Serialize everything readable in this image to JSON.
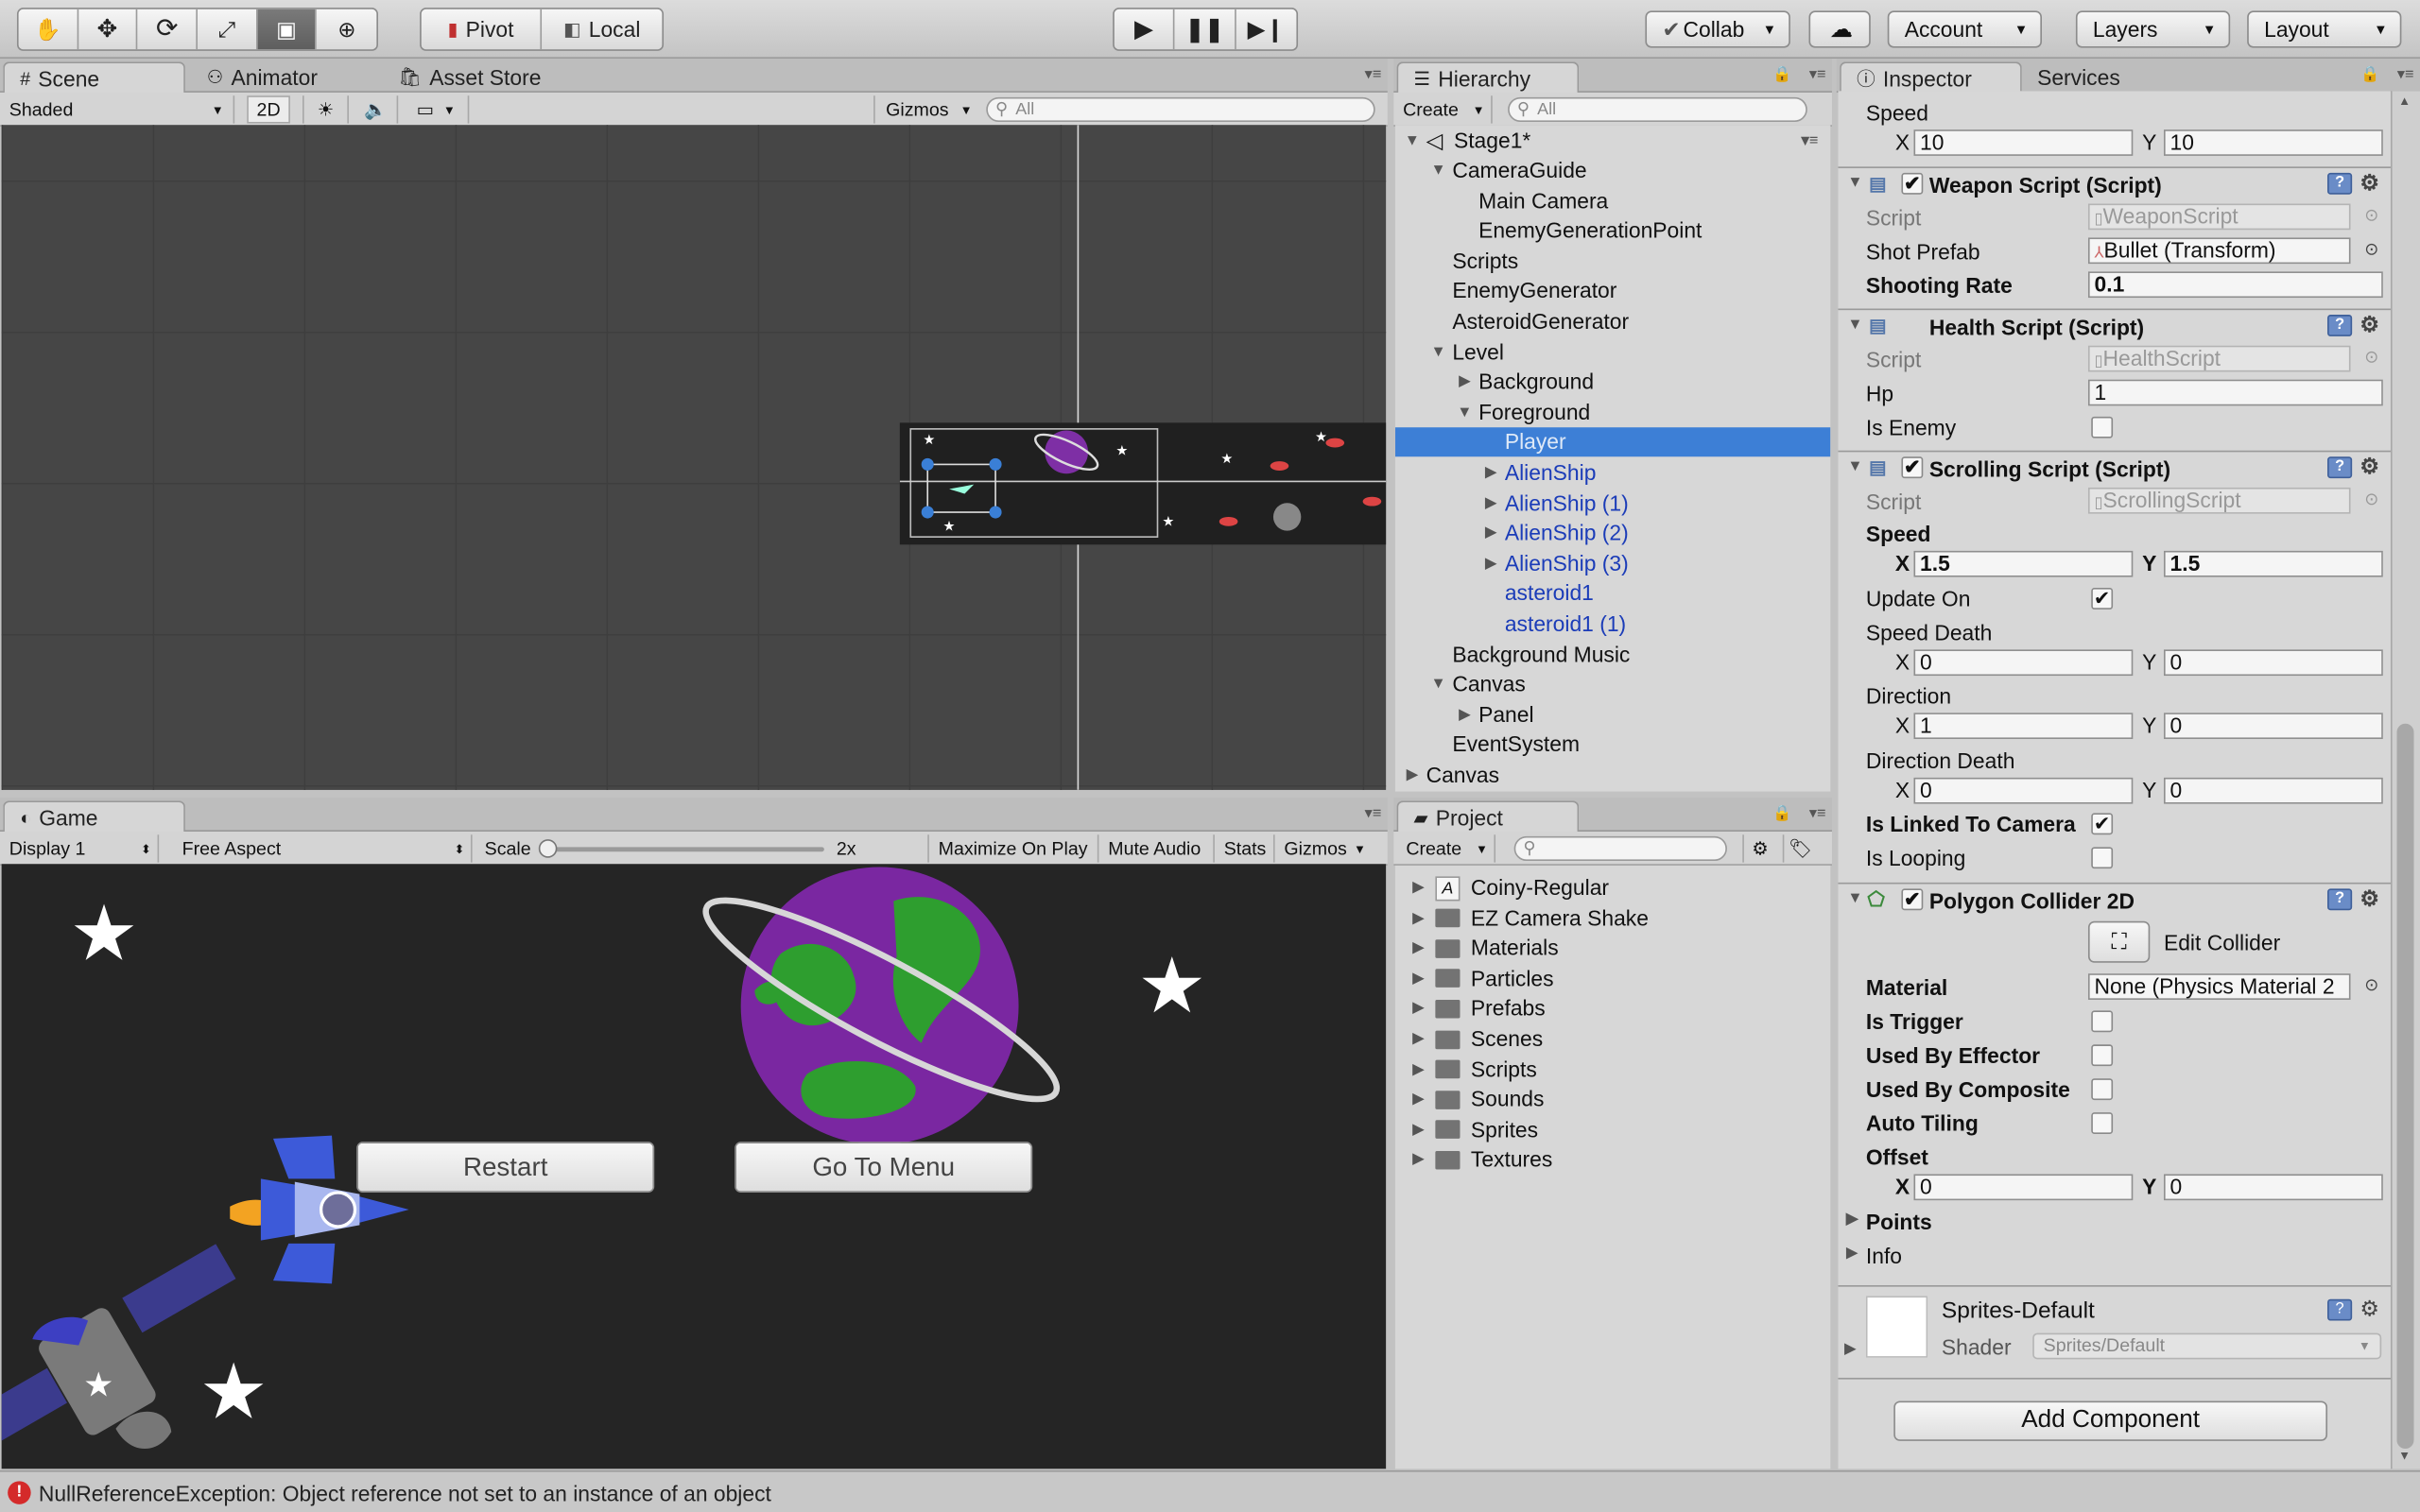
{
  "toolbar": {
    "pivot": "Pivot",
    "local": "Local",
    "collab": "Collab",
    "account": "Account",
    "layers": "Layers",
    "layout": "Layout"
  },
  "scene": {
    "tab_scene": "Scene",
    "tab_animator": "Animator",
    "tab_asset_store": "Asset Store",
    "shading_mode": "Shaded",
    "mode_2d": "2D",
    "gizmos": "Gizmos",
    "search_placeholder": "All"
  },
  "game": {
    "tab": "Game",
    "display": "Display 1",
    "aspect": "Free Aspect",
    "scale_label": "Scale",
    "scale_value": "2x",
    "maximize_on_play": "Maximize On Play",
    "mute_audio": "Mute Audio",
    "stats": "Stats",
    "gizmos": "Gizmos",
    "restart_button": "Restart",
    "go_to_menu_button": "Go To Menu"
  },
  "hierarchy": {
    "tab": "Hierarchy",
    "create": "Create",
    "search_placeholder": "All",
    "scene_name": "Stage1*",
    "rows": [
      {
        "label": "CameraGuide",
        "indent": 1,
        "arrow": "down",
        "style": ""
      },
      {
        "label": "Main Camera",
        "indent": 2,
        "arrow": "",
        "style": ""
      },
      {
        "label": "EnemyGenerationPoint",
        "indent": 2,
        "arrow": "",
        "style": ""
      },
      {
        "label": "Scripts",
        "indent": 1,
        "arrow": "",
        "style": ""
      },
      {
        "label": "EnemyGenerator",
        "indent": 1,
        "arrow": "",
        "style": ""
      },
      {
        "label": "AsteroidGenerator",
        "indent": 1,
        "arrow": "",
        "style": ""
      },
      {
        "label": "Level",
        "indent": 1,
        "arrow": "down",
        "style": ""
      },
      {
        "label": "Background",
        "indent": 2,
        "arrow": "right",
        "style": ""
      },
      {
        "label": "Foreground",
        "indent": 2,
        "arrow": "down",
        "style": ""
      },
      {
        "label": "Player",
        "indent": 3,
        "arrow": "",
        "style": "sel"
      },
      {
        "label": "AlienShip",
        "indent": 3,
        "arrow": "right",
        "style": "blue"
      },
      {
        "label": "AlienShip (1)",
        "indent": 3,
        "arrow": "right",
        "style": "blue"
      },
      {
        "label": "AlienShip (2)",
        "indent": 3,
        "arrow": "right",
        "style": "blue"
      },
      {
        "label": "AlienShip (3)",
        "indent": 3,
        "arrow": "right",
        "style": "blue"
      },
      {
        "label": "asteroid1",
        "indent": 3,
        "arrow": "",
        "style": "blue"
      },
      {
        "label": "asteroid1 (1)",
        "indent": 3,
        "arrow": "",
        "style": "blue"
      },
      {
        "label": "Background Music",
        "indent": 1,
        "arrow": "",
        "style": ""
      },
      {
        "label": "Canvas",
        "indent": 1,
        "arrow": "down",
        "style": ""
      },
      {
        "label": "Panel",
        "indent": 2,
        "arrow": "right",
        "style": ""
      },
      {
        "label": "EventSystem",
        "indent": 1,
        "arrow": "",
        "style": ""
      },
      {
        "label": "Canvas",
        "indent": 0,
        "arrow": "right",
        "style": ""
      }
    ]
  },
  "project": {
    "tab": "Project",
    "create": "Create",
    "items": [
      {
        "label": "Coiny-Regular",
        "kind": "font"
      },
      {
        "label": "EZ Camera Shake",
        "kind": "folder"
      },
      {
        "label": "Materials",
        "kind": "folder"
      },
      {
        "label": "Particles",
        "kind": "folder"
      },
      {
        "label": "Prefabs",
        "kind": "folder"
      },
      {
        "label": "Scenes",
        "kind": "folder"
      },
      {
        "label": "Scripts",
        "kind": "folder"
      },
      {
        "label": "Sounds",
        "kind": "folder"
      },
      {
        "label": "Sprites",
        "kind": "folder"
      },
      {
        "label": "Textures",
        "kind": "folder"
      }
    ]
  },
  "inspector": {
    "tab": "Inspector",
    "tab_services": "Services",
    "speed_label": "Speed",
    "x": "X",
    "y": "Y",
    "speed_x": "10",
    "speed_y": "10",
    "weapon_title": "Weapon Script (Script)",
    "script_label": "Script",
    "weapon_script": "WeaponScript",
    "shot_prefab_label": "Shot Prefab",
    "shot_prefab": "Bullet (Transform)",
    "shooting_rate_label": "Shooting Rate",
    "shooting_rate": "0.1",
    "health_title": "Health Script (Script)",
    "health_script": "HealthScript",
    "hp_label": "Hp",
    "hp": "1",
    "is_enemy_label": "Is Enemy",
    "scrolling_title": "Scrolling Script (Script)",
    "scrolling_script": "ScrollingScript",
    "scroll_speed_x": "1.5",
    "scroll_speed_y": "1.5",
    "update_on_label": "Update On",
    "speed_death_label": "Speed Death",
    "speed_death_x": "0",
    "speed_death_y": "0",
    "direction_label": "Direction",
    "direction_x": "1",
    "direction_y": "0",
    "direction_death_label": "Direction Death",
    "direction_death_x": "0",
    "direction_death_y": "0",
    "linked_label": "Is Linked To Camera",
    "looping_label": "Is Looping",
    "collider_title": "Polygon Collider 2D",
    "edit_collider": "Edit Collider",
    "material_label": "Material",
    "material_value": "None (Physics Material 2",
    "is_trigger_label": "Is Trigger",
    "used_by_effector_label": "Used By Effector",
    "used_by_composite_label": "Used By Composite",
    "auto_tiling_label": "Auto Tiling",
    "offset_label": "Offset",
    "offset_x": "0",
    "offset_y": "0",
    "points_label": "Points",
    "info_label": "Info",
    "material_name": "Sprites-Default",
    "shader_label": "Shader",
    "shader_value": "Sprites/Default",
    "add_component": "Add Component"
  },
  "status": {
    "message": "NullReferenceException: Object reference not set to an instance of an object",
    "color": "#d42a2a"
  }
}
